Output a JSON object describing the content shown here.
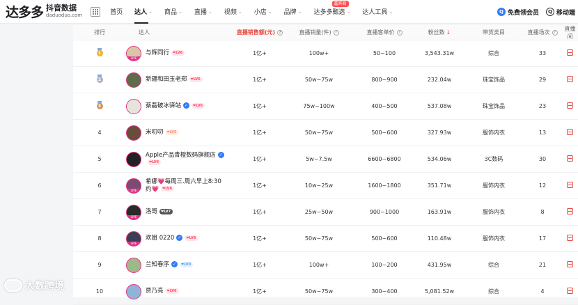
{
  "header": {
    "logo_main": "达多多",
    "logo_cn": "抖音数据",
    "logo_en": "daduoduo.com",
    "nav": [
      {
        "label": "首页",
        "chevron": false,
        "active": false
      },
      {
        "label": "达人",
        "chevron": true,
        "active": true
      },
      {
        "label": "商品",
        "chevron": true,
        "active": false
      },
      {
        "label": "直播",
        "chevron": true,
        "active": false
      },
      {
        "label": "视频",
        "chevron": true,
        "active": false
      },
      {
        "label": "小店",
        "chevron": true,
        "active": false
      },
      {
        "label": "品牌",
        "chevron": true,
        "active": false
      },
      {
        "label": "达多多甄选",
        "chevron": true,
        "active": false,
        "badge": "嘉宾商"
      },
      {
        "label": "达人工具",
        "chevron": true,
        "active": false
      }
    ],
    "member_label": "免费领会员",
    "mobile_label": "移动端"
  },
  "table": {
    "columns": {
      "rank": "排行",
      "person": "达人",
      "sales": "直播销售额(元)",
      "volume": "直播销量(件)",
      "price": "直播客单价",
      "fans": "粉丝数",
      "category": "带货类目",
      "count": "直播场次",
      "room": "直播间"
    },
    "sort_arrow": "↓",
    "rows": [
      {
        "rank": "1",
        "medal": "gold",
        "name": "与辉同行",
        "verified": false,
        "level": "LV6",
        "lvstyle": "pink",
        "sales": "1亿+",
        "volume": "100w+",
        "price": "50~100",
        "fans": "3,543.31w",
        "category": "综合",
        "count": "33",
        "avatar_color": "#d9c6a6",
        "live": true
      },
      {
        "rank": "2",
        "medal": "silver",
        "name": "新疆和田玉老郑",
        "verified": false,
        "level": "LV6",
        "lvstyle": "pink",
        "sales": "1亿+",
        "volume": "50w~75w",
        "price": "800~900",
        "fans": "232.04w",
        "category": "珠宝饰品",
        "count": "29",
        "avatar_color": "#5f6b4a",
        "live": false
      },
      {
        "rank": "3",
        "medal": "bronze",
        "name": "蔡磊破冰驿站",
        "verified": true,
        "level": "LV6",
        "lvstyle": "pink",
        "sales": "1亿+",
        "volume": "75w~100w",
        "price": "400~500",
        "fans": "537.08w",
        "category": "珠宝饰品",
        "count": "23",
        "avatar_color": "#e8e3dc",
        "live": false
      },
      {
        "rank": "4",
        "medal": "",
        "name": "米叨叨",
        "verified": false,
        "level": "LV5",
        "lvstyle": "light",
        "sales": "1亿+",
        "volume": "50w~75w",
        "price": "500~600",
        "fans": "327.93w",
        "category": "服饰内衣",
        "count": "13",
        "avatar_color": "#6a4c3c",
        "live": false
      },
      {
        "rank": "5",
        "medal": "",
        "name": "Apple产品青橙数码旗舰店",
        "verified": true,
        "level": "LV6",
        "lvstyle": "pink",
        "sales": "1亿+",
        "volume": "5w~7.5w",
        "price": "6600~6800",
        "fans": "534.06w",
        "category": "3C数码",
        "count": "30",
        "avatar_color": "#222222",
        "live": false
      },
      {
        "rank": "6",
        "medal": "",
        "name": "希娜💗每周三.周六早上8:30约💗",
        "verified": false,
        "level": "LV6",
        "lvstyle": "pink",
        "sales": "1亿+",
        "volume": "10w~25w",
        "price": "1600~1800",
        "fans": "351.71w",
        "category": "服饰内衣",
        "count": "12",
        "avatar_color": "#7d4a72",
        "live": true
      },
      {
        "rank": "7",
        "medal": "",
        "name": "洛哥",
        "verified": false,
        "level": "LV7",
        "lvstyle": "dark",
        "sales": "1亿+",
        "volume": "25w~50w",
        "price": "900~1000",
        "fans": "163.91w",
        "category": "服饰内衣",
        "count": "8",
        "avatar_color": "#2a2a2a",
        "live": true
      },
      {
        "rank": "8",
        "medal": "",
        "name": "欢姐 0220",
        "verified": true,
        "level": "LV6",
        "lvstyle": "pink",
        "sales": "1亿+",
        "volume": "50w~75w",
        "price": "500~600",
        "fans": "110.48w",
        "category": "服饰内衣",
        "count": "17",
        "avatar_color": "#3b3f55",
        "live": true
      },
      {
        "rank": "9",
        "medal": "",
        "name": "兰知春序",
        "verified": true,
        "level": "LV0",
        "lvstyle": "blue",
        "sales": "1亿+",
        "volume": "100w+",
        "price": "100~200",
        "fans": "431.95w",
        "category": "综合",
        "count": "21",
        "avatar_color": "#9fb88a",
        "live": false
      },
      {
        "rank": "10",
        "medal": "",
        "name": "贾乃亮",
        "verified": false,
        "level": "LV6",
        "lvstyle": "pink",
        "sales": "1亿+",
        "volume": "50w~75w",
        "price": "300~400",
        "fans": "5,081.52w",
        "category": "综合",
        "count": "4",
        "avatar_color": "#8fb4d6",
        "live": false
      }
    ]
  },
  "watermark": "大数跨境",
  "colors": {
    "accent": "#e9473f",
    "brand_blue": "#2f7cf6",
    "live_pink": "#e0358a"
  }
}
